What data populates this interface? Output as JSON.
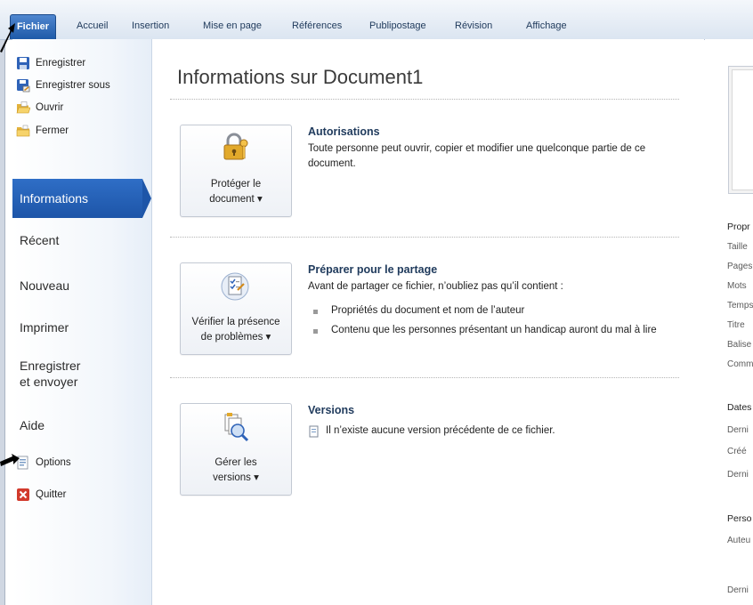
{
  "ribbon": {
    "tabs": [
      {
        "label": "Fichier",
        "active": true
      },
      {
        "label": "Accueil"
      },
      {
        "label": "Insertion"
      },
      {
        "label": "Mise en page"
      },
      {
        "label": "Références"
      },
      {
        "label": "Publipostage"
      },
      {
        "label": "Révision"
      },
      {
        "label": "Affichage"
      }
    ]
  },
  "backstage": {
    "commands": [
      {
        "label": "Enregistrer",
        "icon": "floppy-disk-icon"
      },
      {
        "label": "Enregistrer sous",
        "icon": "save-as-icon"
      },
      {
        "label": "Ouvrir",
        "icon": "open-folder-icon"
      },
      {
        "label": "Fermer",
        "icon": "close-folder-icon"
      }
    ],
    "nav": [
      {
        "label": "Informations",
        "selected": true
      },
      {
        "label": "Récent"
      },
      {
        "label": "Nouveau"
      },
      {
        "label": "Imprimer"
      },
      {
        "label": "Enregistrer\net envoyer"
      },
      {
        "label": "Aide"
      }
    ],
    "bottom_commands": [
      {
        "label": "Options",
        "icon": "options-icon"
      },
      {
        "label": "Quitter",
        "icon": "exit-icon"
      }
    ]
  },
  "main": {
    "title": "Informations sur Document1",
    "sections": [
      {
        "button_label": "Protéger le\ndocument ▾",
        "icon": "padlock-key-icon",
        "title": "Autorisations",
        "text": "Toute personne peut ouvrir, copier et modifier une quelconque partie de ce document."
      },
      {
        "button_label": "Vérifier la présence\nde problèmes ▾",
        "icon": "check-document-icon",
        "title": "Préparer pour le partage",
        "text": "Avant de partager ce fichier, n’oubliez pas qu’il contient :",
        "bullets": [
          "Propriétés du document et nom de l’auteur",
          "Contenu que les personnes présentant un handicap auront du mal à lire"
        ]
      },
      {
        "button_label": "Gérer les\nversions ▾",
        "icon": "versions-icon",
        "title": "Versions",
        "text": "Il n’existe aucune version précédente de ce fichier."
      }
    ]
  },
  "properties_panel": {
    "labels": [
      {
        "text": "Propr",
        "heading": true
      },
      {
        "text": "Taille"
      },
      {
        "text": "Pages"
      },
      {
        "text": "Mots"
      },
      {
        "text": "Temps"
      },
      {
        "text": "Titre"
      },
      {
        "text": "Balise"
      },
      {
        "text": "Comm"
      },
      {
        "text": "Dates",
        "heading": true
      },
      {
        "text": "Derni"
      },
      {
        "text": "Créé"
      },
      {
        "text": "Derni"
      },
      {
        "text": "Perso",
        "heading": true
      },
      {
        "text": "Auteu"
      },
      {
        "text": "Derni"
      }
    ]
  },
  "colors": {
    "file_tab": "#1e5aa8",
    "selected_nav": "#1d55a8",
    "section_title": "#1f3a5c"
  }
}
